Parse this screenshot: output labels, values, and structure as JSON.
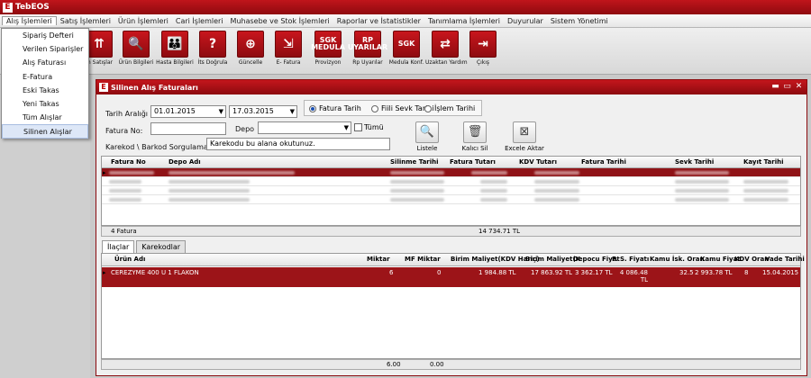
{
  "app": {
    "title": "TebEOS"
  },
  "menu": [
    "Alış İşlemleri",
    "Satış İşlemleri",
    "Ürün İşlemleri",
    "Cari İşlemleri",
    "Muhasebe ve Stok İşlemleri",
    "Raporlar ve İstatistikler",
    "Tanımlama İşlemleri",
    "Duyurular",
    "Sistem Yönetimi"
  ],
  "dropdown": [
    "Sipariş Defteri",
    "Verilen Siparişler",
    "Alış Faturası",
    "E-Fatura",
    "Eski Takas",
    "Yeni Takas",
    "Tüm Alışlar",
    "Silinen Alışlar"
  ],
  "toolbar": [
    {
      "label": "m Satışlar",
      "icon": "⇈"
    },
    {
      "label": "Ürün Bilgileri",
      "icon": "🔍"
    },
    {
      "label": "Hasta Bilgileri",
      "icon": "👪"
    },
    {
      "label": "İts Doğrula",
      "icon": "?"
    },
    {
      "label": "Güncelle",
      "icon": "⊕"
    },
    {
      "label": "E- Fatura",
      "icon": "⇲"
    },
    {
      "label": "Provizyon",
      "icon": "SGK MEDULA"
    },
    {
      "label": "Rp Uyarılar",
      "icon": "RP UYARILAR"
    },
    {
      "label": "Medula Konf.",
      "icon": "SGK"
    },
    {
      "label": "Uzaktan Yardım",
      "icon": "⇄"
    },
    {
      "label": "Çıkış",
      "icon": "⇥"
    }
  ],
  "window": {
    "title": "Silinen Alış Faturaları",
    "date_range_label": "Tarih Aralığı",
    "date_from": "01.01.2015",
    "date_to": "17.03.2015",
    "radios": [
      "Fatura Tarih",
      "Fiili Sevk Tarihi",
      "İşlem Tarihi"
    ],
    "invoice_no_label": "Fatura No:",
    "depot_label": "Depo",
    "all_label": "Tümü",
    "barcode_label": "Karekod \\ Barkod Sorgulama",
    "barcode_placeholder": "Karekodu bu alana okutunuz.",
    "btn_list": "Listele",
    "btn_delete": "Kalıcı Sil",
    "btn_excel": "Excele Aktar"
  },
  "grid1": {
    "columns": [
      "Fatura No",
      "Depo Adı",
      "Silinme Tarihi",
      "Fatura Tutarı",
      "KDV Tutarı",
      "Fatura Tarihi",
      "Sevk Tarihi",
      "Kayıt Tarihi"
    ],
    "row_count_text": "4 Fatura",
    "total": "14 734.71 TL"
  },
  "tabs": [
    "İlaçlar",
    "Karekodlar"
  ],
  "grid2": {
    "columns": [
      "Ürün Adı",
      "Miktar",
      "MF Miktar",
      "Birim Maliyet(KDV Hariç)",
      "Birim Maliyet(K",
      "Depocu Fiyat",
      "P. S. Fiyatı",
      "Kamu İsk. Oran",
      "Kamu Fiyat",
      "KDV Oran",
      "Vade Tarihi"
    ],
    "row": [
      "CEREZYME 400 U 1 FLAKON",
      "6",
      "0",
      "1 984.88 TL",
      "17 863.92 TL",
      "3 362.17 TL",
      "4 086.48 TL",
      "32.5",
      "2 993.78 TL",
      "8",
      "15.04.2015"
    ],
    "sum_qty": "6.00",
    "sum_mf": "0.00"
  }
}
